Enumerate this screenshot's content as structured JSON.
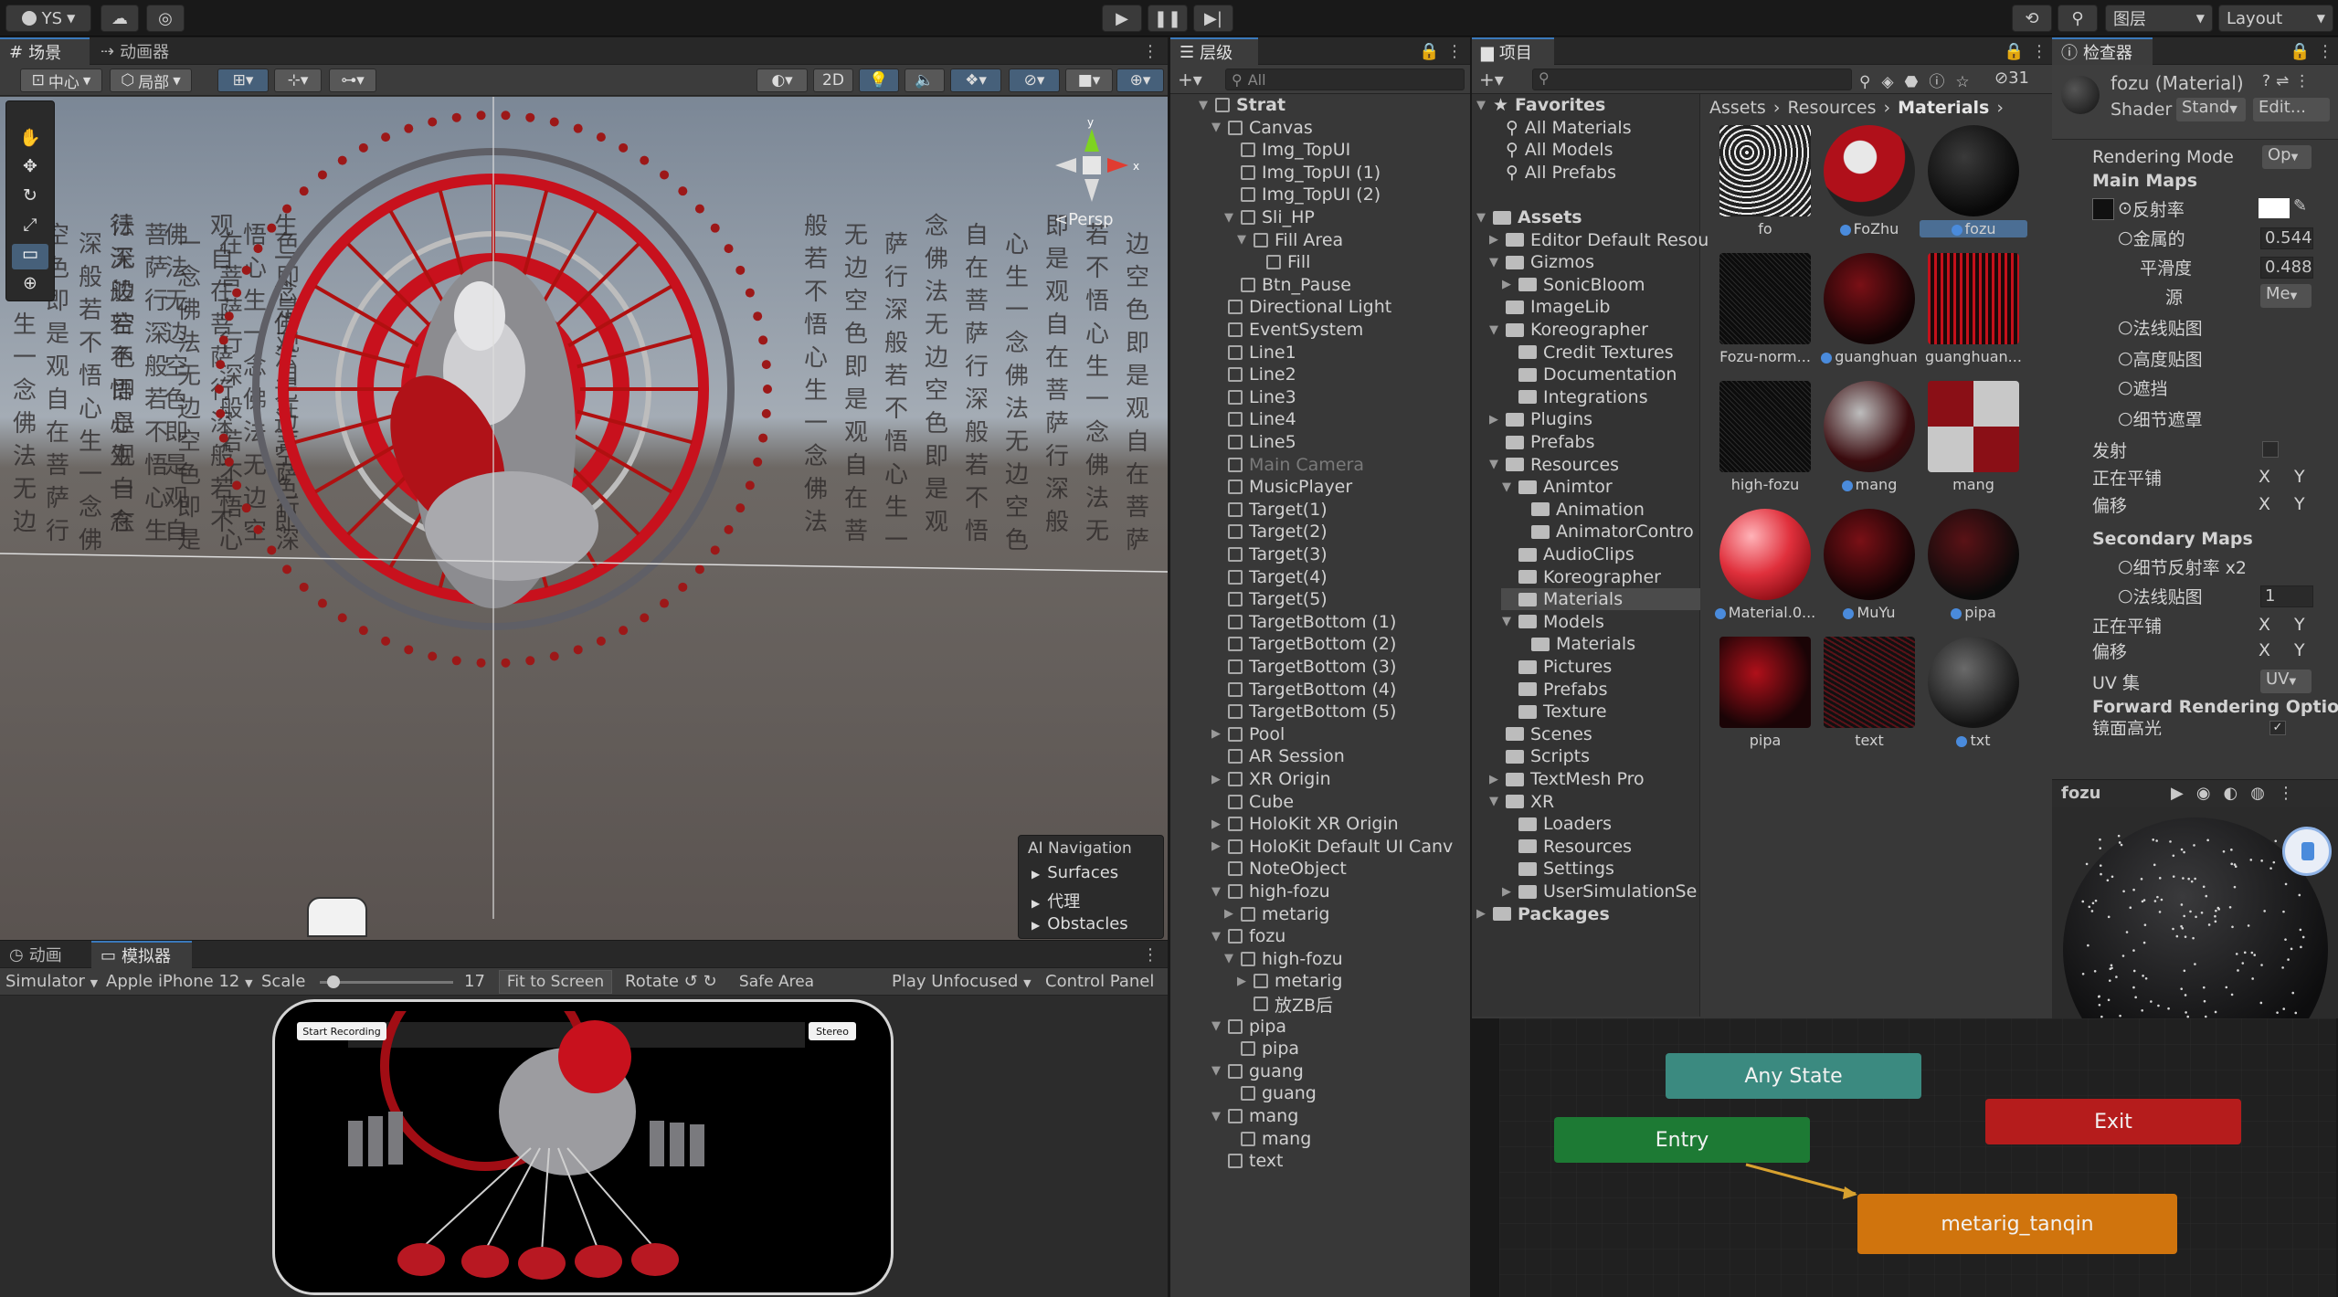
{
  "topbar": {
    "account": "YS",
    "play_icon": "play-icon",
    "pause_icon": "pause-icon",
    "step_icon": "step-icon",
    "layers": "图层",
    "layout": "Layout"
  },
  "scene": {
    "tabs": [
      "场景",
      "动画器"
    ],
    "pivot": "中心",
    "space": "局部",
    "mode_2d": "2D",
    "persp": "<Persp",
    "overlay": {
      "title": "AI Navigation",
      "items": [
        "Surfaces",
        "代理",
        "Obstacles"
      ]
    }
  },
  "simulator": {
    "tabs": [
      "动画",
      "模拟器"
    ],
    "simulator_label": "Simulator",
    "device": "Apple iPhone 12",
    "scale_label": "Scale",
    "scale_value": "17",
    "fit": "Fit to Screen",
    "rotate": "Rotate",
    "safe": "Safe Area",
    "play_mode": "Play Unfocused",
    "control": "Control Panel",
    "start_recording": "Start Recording",
    "stereo": "Stereo"
  },
  "hierarchy": {
    "tab": "层级",
    "search_placeholder": "All",
    "items": [
      {
        "label": "Strat",
        "depth": 0,
        "bold": true,
        "arrow": "▼"
      },
      {
        "label": "Canvas",
        "depth": 1,
        "arrow": "▼"
      },
      {
        "label": "Img_TopUI",
        "depth": 2
      },
      {
        "label": "Img_TopUI (1)",
        "depth": 2
      },
      {
        "label": "Img_TopUI (2)",
        "depth": 2
      },
      {
        "label": "Sli_HP",
        "depth": 2,
        "arrow": "▼"
      },
      {
        "label": "Fill Area",
        "depth": 3,
        "arrow": "▼"
      },
      {
        "label": "Fill",
        "depth": 4
      },
      {
        "label": "Btn_Pause",
        "depth": 2
      },
      {
        "label": "Directional Light",
        "depth": 1
      },
      {
        "label": "EventSystem",
        "depth": 1
      },
      {
        "label": "Line1",
        "depth": 1
      },
      {
        "label": "Line2",
        "depth": 1
      },
      {
        "label": "Line3",
        "depth": 1
      },
      {
        "label": "Line4",
        "depth": 1
      },
      {
        "label": "Line5",
        "depth": 1
      },
      {
        "label": "Main Camera",
        "depth": 1,
        "dim": true
      },
      {
        "label": "MusicPlayer",
        "depth": 1
      },
      {
        "label": "Target(1)",
        "depth": 1
      },
      {
        "label": "Target(2)",
        "depth": 1
      },
      {
        "label": "Target(3)",
        "depth": 1
      },
      {
        "label": "Target(4)",
        "depth": 1
      },
      {
        "label": "Target(5)",
        "depth": 1
      },
      {
        "label": "TargetBottom (1)",
        "depth": 1
      },
      {
        "label": "TargetBottom (2)",
        "depth": 1
      },
      {
        "label": "TargetBottom (3)",
        "depth": 1
      },
      {
        "label": "TargetBottom (4)",
        "depth": 1
      },
      {
        "label": "TargetBottom (5)",
        "depth": 1
      },
      {
        "label": "Pool",
        "depth": 1,
        "arrow": "▶"
      },
      {
        "label": "AR Session",
        "depth": 1
      },
      {
        "label": "XR Origin",
        "depth": 1,
        "arrow": "▶"
      },
      {
        "label": "Cube",
        "depth": 1
      },
      {
        "label": "HoloKit XR Origin",
        "depth": 1,
        "arrow": "▶"
      },
      {
        "label": "HoloKit Default UI Canv",
        "depth": 1,
        "arrow": "▶"
      },
      {
        "label": "NoteObject",
        "depth": 1
      },
      {
        "label": "high-fozu",
        "depth": 1,
        "arrow": "▼"
      },
      {
        "label": "metarig",
        "depth": 2,
        "arrow": "▶"
      },
      {
        "label": "fozu",
        "depth": 1,
        "arrow": "▼"
      },
      {
        "label": "high-fozu",
        "depth": 2,
        "arrow": "▼"
      },
      {
        "label": "metarig",
        "depth": 3,
        "arrow": "▶"
      },
      {
        "label": "放ZB后",
        "depth": 3
      },
      {
        "label": "pipa",
        "depth": 1,
        "arrow": "▼"
      },
      {
        "label": "pipa",
        "depth": 2
      },
      {
        "label": "guang",
        "depth": 1,
        "arrow": "▼"
      },
      {
        "label": "guang",
        "depth": 2
      },
      {
        "label": "mang",
        "depth": 1,
        "arrow": "▼"
      },
      {
        "label": "mang",
        "depth": 2
      },
      {
        "label": "text",
        "depth": 1
      }
    ]
  },
  "project": {
    "tab": "项目",
    "hidden_count": "31",
    "breadcrumb": [
      "Assets",
      "Resources",
      "Materials"
    ],
    "tree": [
      {
        "label": "Favorites",
        "depth": 0,
        "bold": true,
        "arrow": "▼",
        "icon": "star"
      },
      {
        "label": "All Materials",
        "depth": 1,
        "icon": "search"
      },
      {
        "label": "All Models",
        "depth": 1,
        "icon": "search"
      },
      {
        "label": "All Prefabs",
        "depth": 1,
        "icon": "search"
      },
      {
        "label": "",
        "depth": 0,
        "icon": "none"
      },
      {
        "label": "Assets",
        "depth": 0,
        "bold": true,
        "arrow": "▼",
        "icon": "folder"
      },
      {
        "label": "Editor Default Resou",
        "depth": 1,
        "arrow": "▶",
        "icon": "folder"
      },
      {
        "label": "Gizmos",
        "depth": 1,
        "arrow": "▼",
        "icon": "folder"
      },
      {
        "label": "SonicBloom",
        "depth": 2,
        "arrow": "▶",
        "icon": "folder"
      },
      {
        "label": "ImageLib",
        "depth": 1,
        "icon": "folder"
      },
      {
        "label": "Koreographer",
        "depth": 1,
        "arrow": "▼",
        "icon": "folder"
      },
      {
        "label": "Credit Textures",
        "depth": 2,
        "icon": "folder"
      },
      {
        "label": "Documentation",
        "depth": 2,
        "icon": "folder"
      },
      {
        "label": "Integrations",
        "depth": 2,
        "icon": "folder"
      },
      {
        "label": "Plugins",
        "depth": 1,
        "arrow": "▶",
        "icon": "folder"
      },
      {
        "label": "Prefabs",
        "depth": 1,
        "icon": "folder"
      },
      {
        "label": "Resources",
        "depth": 1,
        "arrow": "▼",
        "icon": "folder"
      },
      {
        "label": "Animtor",
        "depth": 2,
        "arrow": "▼",
        "icon": "folder"
      },
      {
        "label": "Animation",
        "depth": 3,
        "icon": "folder"
      },
      {
        "label": "AnimatorContro",
        "depth": 3,
        "icon": "folder"
      },
      {
        "label": "AudioClips",
        "depth": 2,
        "icon": "folder"
      },
      {
        "label": "Koreographer",
        "depth": 2,
        "icon": "folder"
      },
      {
        "label": "Materials",
        "depth": 2,
        "icon": "folder",
        "selected": true
      },
      {
        "label": "Models",
        "depth": 2,
        "arrow": "▼",
        "icon": "folder"
      },
      {
        "label": "Materials",
        "depth": 3,
        "icon": "folder"
      },
      {
        "label": "Pictures",
        "depth": 2,
        "icon": "folder"
      },
      {
        "label": "Prefabs",
        "depth": 2,
        "icon": "folder"
      },
      {
        "label": "Texture",
        "depth": 2,
        "icon": "folder"
      },
      {
        "label": "Scenes",
        "depth": 1,
        "icon": "folder"
      },
      {
        "label": "Scripts",
        "depth": 1,
        "icon": "folder"
      },
      {
        "label": "TextMesh Pro",
        "depth": 1,
        "arrow": "▶",
        "icon": "folder"
      },
      {
        "label": "XR",
        "depth": 1,
        "arrow": "▼",
        "icon": "folder"
      },
      {
        "label": "Loaders",
        "depth": 2,
        "icon": "folder"
      },
      {
        "label": "Resources",
        "depth": 2,
        "icon": "folder"
      },
      {
        "label": "Settings",
        "depth": 2,
        "icon": "folder"
      },
      {
        "label": "UserSimulationSe",
        "depth": 2,
        "arrow": "▶",
        "icon": "folder"
      },
      {
        "label": "Packages",
        "depth": 0,
        "bold": true,
        "arrow": "▶",
        "icon": "folder"
      }
    ],
    "assets": [
      {
        "label": "fo",
        "kind": "texture-noise",
        "badge": false
      },
      {
        "label": "FoZhu",
        "kind": "sphere-red-white",
        "badge": true
      },
      {
        "label": "fozu",
        "kind": "sphere-dark",
        "badge": true,
        "selected": true
      },
      {
        "label": "Fozu-norm...",
        "kind": "texture-dark",
        "badge": false
      },
      {
        "label": "guanghuan",
        "kind": "sphere-darkred",
        "badge": true
      },
      {
        "label": "guanghuan...",
        "kind": "texture-red",
        "badge": false
      },
      {
        "label": "high-fozu",
        "kind": "texture-dark",
        "badge": false
      },
      {
        "label": "mang",
        "kind": "sphere-checker",
        "badge": true
      },
      {
        "label": "mang",
        "kind": "texture-checker",
        "badge": false
      },
      {
        "label": "Material.0...",
        "kind": "sphere-red",
        "badge": true
      },
      {
        "label": "MuYu",
        "kind": "sphere-darkred",
        "badge": true
      },
      {
        "label": "pipa",
        "kind": "sphere-dark-red",
        "badge": true
      },
      {
        "label": "pipa",
        "kind": "texture-red-dark",
        "badge": false
      },
      {
        "label": "text",
        "kind": "texture-grain",
        "badge": false
      },
      {
        "label": "txt",
        "kind": "sphere-grey",
        "badge": true
      }
    ]
  },
  "inspector": {
    "tab": "检查器",
    "name": "fozu (Material)",
    "shader_label": "Shader",
    "shader_value": "Stand",
    "edit": "Edit...",
    "rendering_mode_label": "Rendering Mode",
    "rendering_mode_value": "Op",
    "main_maps": "Main Maps",
    "albedo": "反射率",
    "metallic": "金属的",
    "metallic_value": "0.544",
    "smoothness": "平滑度",
    "smoothness_value": "0.488",
    "source": "源",
    "source_value": "Me",
    "normal": "法线贴图",
    "height": "高度贴图",
    "occlusion": "遮挡",
    "detail_mask": "细节遮罩",
    "emission": "发射",
    "tiling": "正在平铺",
    "offset": "偏移",
    "x": "X",
    "y": "Y",
    "secondary_maps": "Secondary Maps",
    "detail_albedo": "细节反射率 x2",
    "detail_normal": "法线贴图",
    "detail_normal_value": "1",
    "tiling2": "正在平铺",
    "offset2": "偏移",
    "uv_set": "UV 集",
    "uv_value": "UV",
    "forward_options": "Forward Rendering Optio",
    "specular": "镜面高光",
    "preview_name": "fozu"
  },
  "animator": {
    "nodes": {
      "any": "Any State",
      "entry": "Entry",
      "exit": "Exit",
      "state": "metarig_tanqin"
    }
  },
  "colors": {
    "accent": "#3a79bb",
    "entry": "#1d7a34",
    "exit": "#b51c1c",
    "state": "#d0740d",
    "any": "#3b8a80",
    "red": "#c8111d"
  }
}
